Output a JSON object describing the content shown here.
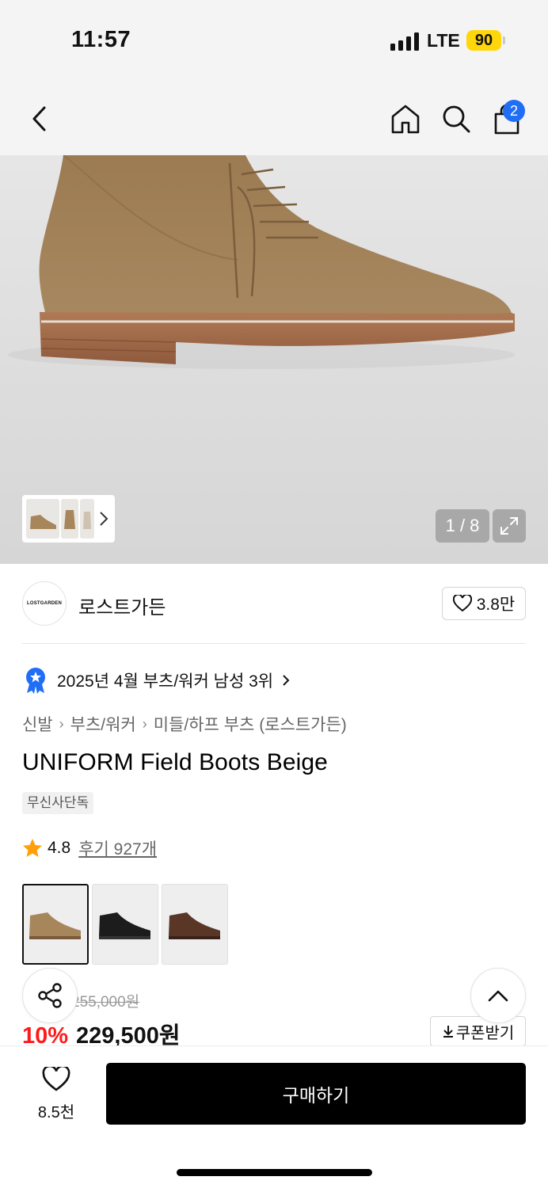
{
  "status": {
    "time": "11:57",
    "network": "LTE",
    "battery": "90"
  },
  "header": {
    "cart_count": "2"
  },
  "gallery": {
    "counter": "1 / 8"
  },
  "brand": {
    "logo_text": "LOSTGARDEN",
    "name": "로스트가든",
    "likes": "3.8만"
  },
  "rank": {
    "text": "2025년 4월 부츠/워커 남성 3위"
  },
  "breadcrumb": [
    "신발",
    "부츠/워커",
    "미들/하프 부츠 (로스트가든)"
  ],
  "product": {
    "title": "UNIFORM Field Boots Beige",
    "tag": "무신사단독",
    "rating": "4.8",
    "review_label": "후기 927개",
    "original_price": "255,000원",
    "discount": "10%",
    "price": "229,500원",
    "coupon_label": "쿠폰받기"
  },
  "colors": [
    {
      "name": "beige",
      "hex": "#a8865c"
    },
    {
      "name": "black",
      "hex": "#1c1c1c"
    },
    {
      "name": "brown",
      "hex": "#5a3626"
    }
  ],
  "bottom": {
    "wish_count": "8.5천",
    "buy_label": "구매하기"
  }
}
